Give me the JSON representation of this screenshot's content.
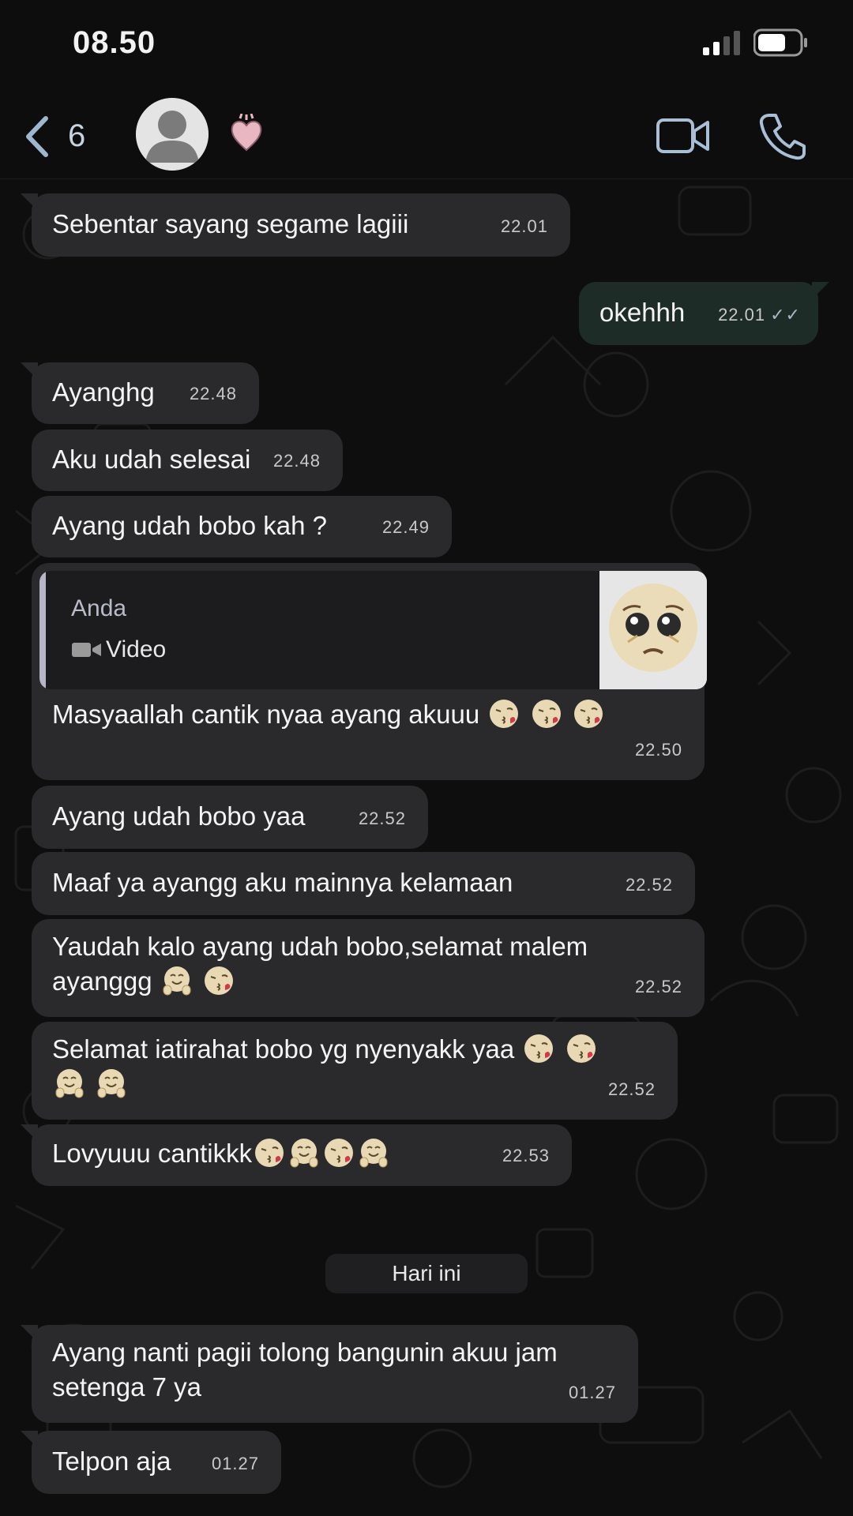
{
  "status_bar": {
    "time": "08.50"
  },
  "header": {
    "back_count": "6"
  },
  "messages": [
    {
      "text": "Sebentar sayang segame lagiii",
      "time": "22.01"
    },
    {
      "text": "okehhh",
      "time": "22.01"
    },
    {
      "text": "Ayanghg",
      "time": "22.48"
    },
    {
      "text": "Aku udah selesai",
      "time": "22.48"
    },
    {
      "text": "Ayang udah bobo kah ?",
      "time": "22.49"
    },
    {
      "quote_author": "Anda",
      "quote_type": "Video",
      "text": "Masyaallah cantik nyaa ayang akuuu",
      "time": "22.50"
    },
    {
      "text": "Ayang udah bobo yaa",
      "time": "22.52"
    },
    {
      "text": "Maaf ya ayangg aku mainnya kelamaan",
      "time": "22.52"
    },
    {
      "text": "Yaudah kalo ayang udah bobo,selamat malem",
      "text2": "ayanggg",
      "time": "22.52"
    },
    {
      "text": "Selamat iatirahat bobo yg nyenyakk yaa",
      "time": "22.52"
    },
    {
      "text": "Lovyuuu cantikkk",
      "time": "22.53"
    },
    {
      "text": "Ayang nanti pagii tolong bangunin akuu jam",
      "text2": "setenga 7 ya",
      "time": "01.27"
    },
    {
      "text": "Telpon aja",
      "time": "01.27"
    }
  ],
  "date_separator": "Hari ini",
  "colors": {
    "background": "#0b0b0b",
    "incoming_bubble": "#2a2a2d",
    "outgoing_bubble": "#1d2c27"
  },
  "icons": [
    "back-chevron-icon",
    "avatar-icon",
    "heart-emoji-icon",
    "video-call-icon",
    "phone-icon",
    "double-check-icon",
    "kiss-emoji-icon",
    "hug-emoji-icon",
    "pleading-emoji-icon",
    "video-icon"
  ]
}
